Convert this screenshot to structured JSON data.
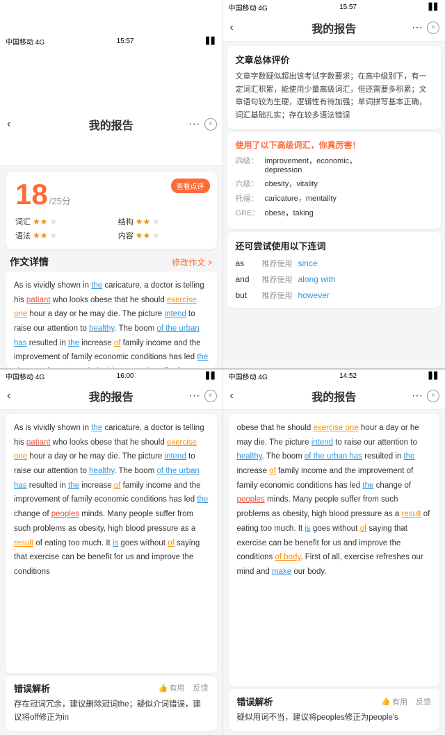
{
  "topLeft": {
    "statusBar": {
      "carrier": "中国移动 4G",
      "time": "15:57"
    },
    "navTitle": "我的报告",
    "scoreCard": {
      "checkBtnLabel": "查看点评",
      "scoreNum": "18",
      "scoreDenom": "/25分",
      "metrics": [
        {
          "label": "词汇",
          "filled": 2,
          "empty": 1
        },
        {
          "label": "结构",
          "filled": 2,
          "empty": 1
        },
        {
          "label": "语法",
          "filled": 2,
          "empty": 1
        },
        {
          "label": "内容",
          "filled": 2,
          "empty": 1
        }
      ]
    },
    "sectionTitle": "作文详情",
    "sectionLink": "修改作文 >",
    "essayText": "As is vividly shown in the caricature, a doctor is telling his patiant who looks obese that he should exercise one hour a day or he may die. The picture intend to raise our attention to healthy. The boom of the urban has resulted in the increase of family income and the improvement of family economic conditions has led the change of peoples minds. Many people suffer from such problems as obesity, high blood pressure as a result of eating too much. It is goes without of saying that exercise can be"
  },
  "topRight": {
    "statusBar": {
      "carrier": "中国移动 4G",
      "time": "15:57"
    },
    "navTitle": "我的报告",
    "overallTitle": "文章总体评价",
    "overallText": "文章字数疑似超出该考试字数要求；在高中级别下，有一定词汇积累，能使用少量高级词汇，但还需要多积累；文章语句较为生硬，逻辑性有待加强；单词拼写基本正确，词汇基础扎实；存在较多语法错误",
    "vocabTitle": "使用了以下高级词汇，你真厉害！",
    "vocabItems": [
      {
        "level": "四级：",
        "words": "improvement，economic，depression"
      },
      {
        "level": "六级：",
        "words": "obesity，vitality"
      },
      {
        "level": "托福：",
        "words": "caricature，mentality"
      },
      {
        "level": "GRE：",
        "words": "obese，taking"
      }
    ],
    "connectorTitle": "还可尝试使用以下连词",
    "connectorItems": [
      {
        "word": "as",
        "suggest": "推荐使用",
        "alt": "since"
      },
      {
        "word": "and",
        "suggest": "推荐使用",
        "alt": "along with"
      },
      {
        "word": "but",
        "suggest": "推荐使用",
        "alt": "however"
      }
    ]
  },
  "bottomLeft": {
    "statusBar": {
      "carrier": "中国移动 4G",
      "time": "16:00"
    },
    "navTitle": "我的报告",
    "essayText": "As is vividly shown in the caricature, a doctor is telling his patiant who looks obese that he should exercise one hour a day or he may die. The picture intend to raise our attention to healthy. The boom of the urban has resulted in the increase of family income and the improvement of family economic conditions has led the change of peoples minds. Many people suffer from such problems as obesity, high blood pressure as a result of eating too much. It is goes without of saying that exercise can be benefit for us and improve the conditions",
    "errorTitle": "错误解析",
    "errorActionHelpful": "有用",
    "errorActionFeedback": "反馈",
    "errorContent": "存在冠词冗余，建议删除冠词the；疑似介词错误，建议将off修正为in"
  },
  "bottomRight": {
    "statusBar": {
      "carrier": "中国移动 4G",
      "time": "14:52"
    },
    "navTitle": "我的报告",
    "essayText": "obese that he should exercise one hour a day or he may die. The picture intend to raise our attention to healthy. The boom of the urban has resulted in the increase of family income and the improvement of family economic conditions has led the change of peoples minds. Many people suffer from such problems as obesity, high blood pressure as a result of eating too much. It is goes without of saying that exercise can be benefit for us and improve the conditions of body. First of all, exercise refreshes our mind and make our body.",
    "errorTitle": "错误解析",
    "errorActionHelpful": "有用",
    "errorActionFeedback": "反馈",
    "errorContent": "疑似用词不当，建议将peoples修正为people's"
  }
}
